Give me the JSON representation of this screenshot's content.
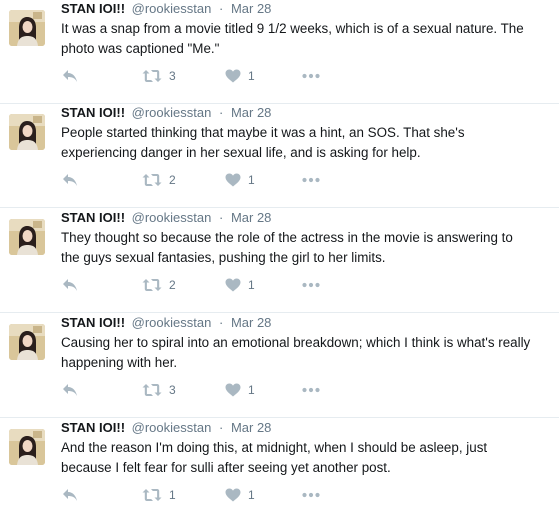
{
  "tweets": [
    {
      "name": "STAN IOI!!",
      "handle": "@rookiesstan",
      "separator": "·",
      "date": "Mar 28",
      "lines": [
        "It was a snap from a movie titled 9 1/2 weeks, which is of a sexual nature. The",
        "photo was captioned \"Me.\""
      ],
      "retweets": "3",
      "likes": "1"
    },
    {
      "name": "STAN IOI!!",
      "handle": "@rookiesstan",
      "separator": "·",
      "date": "Mar 28",
      "lines": [
        "People started thinking that maybe it was a hint, an SOS. That she's",
        "experiencing danger in her sexual life, and is asking for help."
      ],
      "retweets": "2",
      "likes": "1"
    },
    {
      "name": "STAN IOI!!",
      "handle": "@rookiesstan",
      "separator": "·",
      "date": "Mar 28",
      "lines": [
        "They thought so because the role of the actress in the movie is answering to",
        "the guys sexual fantasies, pushing the girl to her limits."
      ],
      "retweets": "2",
      "likes": "1"
    },
    {
      "name": "STAN IOI!!",
      "handle": "@rookiesstan",
      "separator": "·",
      "date": "Mar 28",
      "lines": [
        "Causing her to spiral into an emotional breakdown; which I think is what's really",
        "happening with her."
      ],
      "retweets": "3",
      "likes": "1"
    },
    {
      "name": "STAN IOI!!",
      "handle": "@rookiesstan",
      "separator": "·",
      "date": "Mar 28",
      "lines": [
        "And the reason I'm doing this, at midnight, when I should be asleep, just",
        "because I felt fear for sulli after seeing yet another post."
      ],
      "retweets": "1",
      "likes": "1"
    }
  ],
  "icons": {
    "reply": "reply-icon",
    "retweet": "retweet-icon",
    "like": "heart-icon",
    "more": "more-dots-icon"
  },
  "colors": {
    "action_icon": "#aab8c2",
    "meta_text": "#657786",
    "divider": "#e6ecf0",
    "name_text": "#14171a"
  }
}
